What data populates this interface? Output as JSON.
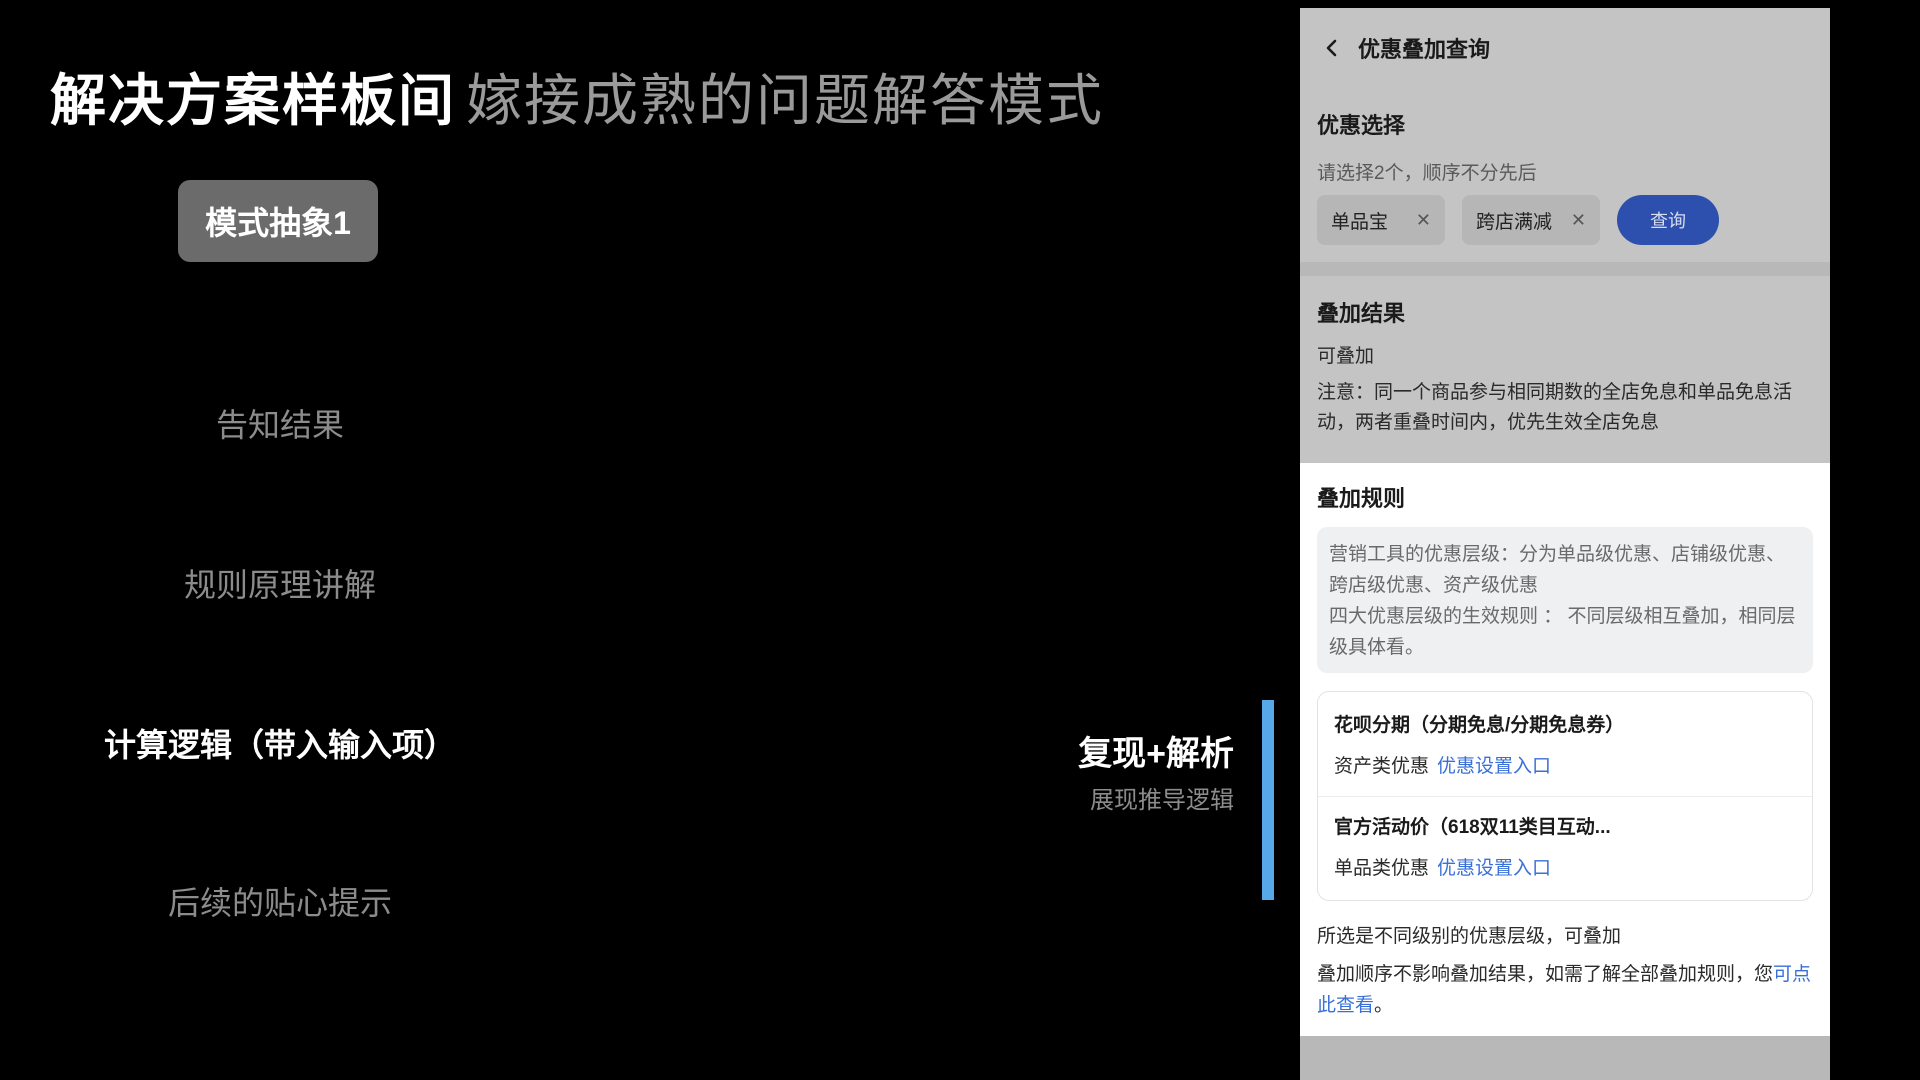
{
  "slide": {
    "title": "解决方案样板间",
    "subtitle": "嫁接成熟的问题解答模式"
  },
  "steps": {
    "active": "模式抽象1",
    "items": [
      "告知结果",
      "规则原理讲解",
      "计算逻辑（带入输入项）",
      "后续的贴心提示"
    ]
  },
  "callout": {
    "title": "复现+解析",
    "subtitle": "展现推导逻辑"
  },
  "phone": {
    "nav_title": "优惠叠加查询",
    "selection": {
      "title": "优惠选择",
      "hint": "请选择2个，顺序不分先后",
      "chips": [
        "单品宝",
        "跨店满减"
      ],
      "query_label": "查询"
    },
    "result": {
      "title": "叠加结果",
      "status": "可叠加",
      "note": "注意：同一个商品参与相同期数的全店免息和单品免息活动，两者重叠时间内，优先生效全店免息"
    },
    "rules": {
      "title": "叠加规则",
      "desc_line1": "营销工具的优惠层级：分为单品级优惠、店铺级优惠、跨店级优惠、资产级优惠",
      "desc_line2": "四大优惠层级的生效规则 ： 不同层级相互叠加，相同层级具体看。",
      "items": [
        {
          "name": "花呗分期（分期免息/分期免息券）",
          "type": "资产类优惠",
          "link": "优惠设置入口"
        },
        {
          "name": "官方活动价（618双11类目互动...",
          "type": "单品类优惠",
          "link": "优惠设置入口"
        }
      ],
      "conclusion": "所选是不同级别的优惠层级，可叠加",
      "footer_text": "叠加顺序不影响叠加结果，如需了解全部叠加规则，您",
      "footer_link": "可点此查看",
      "footer_end": "。"
    }
  }
}
